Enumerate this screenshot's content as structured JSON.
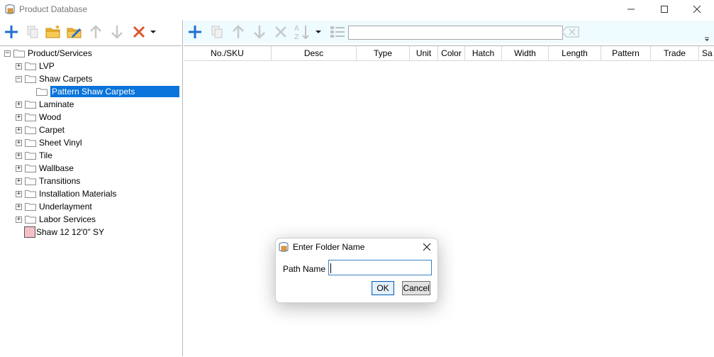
{
  "window": {
    "title": "Product Database",
    "icon": "database-icon"
  },
  "toolbar_left": {
    "icons": [
      "add-icon",
      "copy-icon",
      "new-folder-icon",
      "edit-folder-icon",
      "move-up-icon",
      "move-down-icon",
      "delete-icon",
      "dropdown-icon"
    ]
  },
  "toolbar_right": {
    "icons": [
      "add-icon",
      "copy-icon",
      "move-up-icon",
      "move-down-icon",
      "delete-icon",
      "sort-az-icon",
      "dropdown-icon",
      "list-view-icon",
      "clear-search-icon"
    ],
    "search_value": ""
  },
  "tree": {
    "items": [
      {
        "label": "Product/Services",
        "level": 0,
        "expander": "−",
        "icon": "folder-icon"
      },
      {
        "label": "LVP",
        "level": 1,
        "expander": "+",
        "icon": "folder-icon"
      },
      {
        "label": "Shaw Carpets",
        "level": 1,
        "expander": "−",
        "icon": "folder-icon"
      },
      {
        "label": "Pattern Shaw Carpets",
        "level": 2,
        "expander": "",
        "icon": "folder-icon",
        "selected": true
      },
      {
        "label": "Laminate",
        "level": 1,
        "expander": "+",
        "icon": "folder-icon"
      },
      {
        "label": "Wood",
        "level": 1,
        "expander": "+",
        "icon": "folder-icon"
      },
      {
        "label": "Carpet",
        "level": 1,
        "expander": "+",
        "icon": "folder-icon"
      },
      {
        "label": "Sheet Vinyl",
        "level": 1,
        "expander": "+",
        "icon": "folder-icon"
      },
      {
        "label": "Tile",
        "level": 1,
        "expander": "+",
        "icon": "folder-icon"
      },
      {
        "label": "Wallbase",
        "level": 1,
        "expander": "+",
        "icon": "folder-icon"
      },
      {
        "label": "Transitions",
        "level": 1,
        "expander": "+",
        "icon": "folder-icon"
      },
      {
        "label": "Installation Materials",
        "level": 1,
        "expander": "+",
        "icon": "folder-icon"
      },
      {
        "label": "Underlayment",
        "level": 1,
        "expander": "+",
        "icon": "folder-icon"
      },
      {
        "label": "Labor Services",
        "level": 1,
        "expander": "+",
        "icon": "folder-icon"
      },
      {
        "label": "Shaw 12 12'0\" SY",
        "level": 1,
        "expander": "",
        "icon": "product-swatch-icon",
        "swatch_color": "#f4c2c6"
      }
    ]
  },
  "grid": {
    "columns": [
      "No./SKU",
      "Desc",
      "Type",
      "Unit",
      "Color",
      "Hatch",
      "Width",
      "Length",
      "Pattern",
      "Trade",
      "Sa"
    ]
  },
  "dialog": {
    "title": "Enter Folder Name",
    "field_label": "Path Name",
    "field_value": "",
    "ok_label": "OK",
    "cancel_label": "Cancel"
  },
  "colors": {
    "accent_blue": "#0a74da",
    "add_blue": "#1f6fd1",
    "delete_orange": "#e0542b",
    "folder_yellow": "#f2b634",
    "toolbar_right_bg": "#eefbff"
  }
}
